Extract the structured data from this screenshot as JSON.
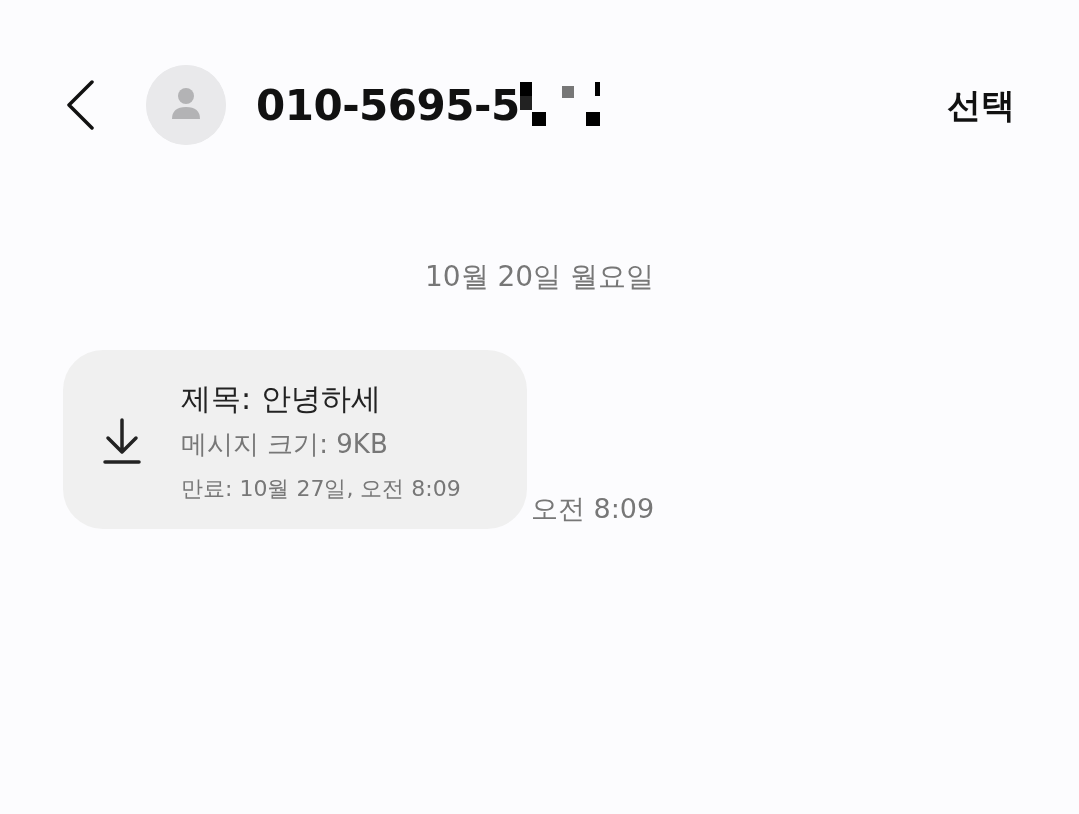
{
  "header": {
    "contact_name": "010-5695-5",
    "action": "선택"
  },
  "date_divider": "10월 20일 월요일",
  "messages": [
    {
      "kind": "mms_download",
      "subject": "제목: 안녕하세",
      "size": "메시지 크기: 9KB",
      "expiry": "만료: 10월 27일, 오전 8:09",
      "time": "오전 8:09"
    }
  ]
}
